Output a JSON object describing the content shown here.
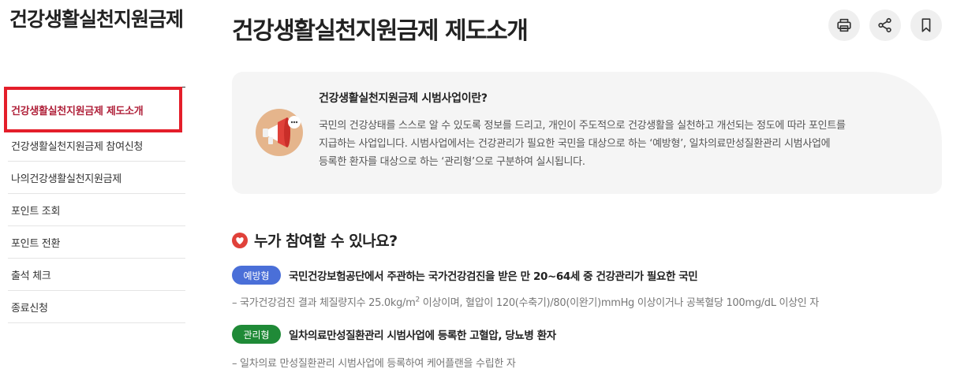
{
  "sidebar": {
    "title": "건강생활실천지원금제",
    "items": [
      {
        "label": "건강생활실천지원금제 제도소개",
        "active": true
      },
      {
        "label": "건강생활실천지원금제 참여신청"
      },
      {
        "label": "나의건강생활실천지원금제"
      },
      {
        "label": "포인트 조회"
      },
      {
        "label": "포인트 전환"
      },
      {
        "label": "출석 체크"
      },
      {
        "label": "종료신청"
      }
    ]
  },
  "header": {
    "title": "건강생활실천지원금제 제도소개",
    "tools": [
      "print-icon",
      "share-icon",
      "bookmark-icon"
    ]
  },
  "info": {
    "icon": "megaphone-icon",
    "heading": "건강생활실천지원금제 시범사업이란?",
    "lines": [
      "국민의 건강상태를 스스로 알 수 있도록 정보를 드리고, 개인이 주도적으로 건강생활을 실천하고 개선되는 정도에 따라 포인트를",
      "지급하는 사업입니다. 시범사업에서는 건강관리가 필요한 국민을 대상으로 하는 ‘예방형’, 일차의료만성질환관리 시범사업에",
      "등록한 환자를 대상으로 하는 ‘관리형’으로 구분하여 실시됩니다."
    ]
  },
  "section": {
    "icon": "heart-icon",
    "title": "누가 참여할 수 있나요?",
    "items": [
      {
        "badge": "예방형",
        "badge_color": "#4a6fd8",
        "title": "국민건강보험공단에서 주관하는 국가건강검진을 받은 만 20~64세 중 건강관리가 필요한 국민",
        "desc_before": "– 국가건강검진 결과 체질량지수 25.0kg/m",
        "desc_sup": "2",
        "desc_after": " 이상이며, 혈압이 120(수축기)/80(이완기)mmHg 이상이거나 공복혈당 100mg/dL 이상인 자"
      },
      {
        "badge": "관리형",
        "badge_color": "#1f8a37",
        "title": "일차의료만성질환관리 시범사업에 등록한 고혈압, 당뇨병 환자",
        "desc_before": "– 일차의료 만성질환관리 시범사업에 등록하여 케어플랜을 수립한 자"
      }
    ]
  }
}
